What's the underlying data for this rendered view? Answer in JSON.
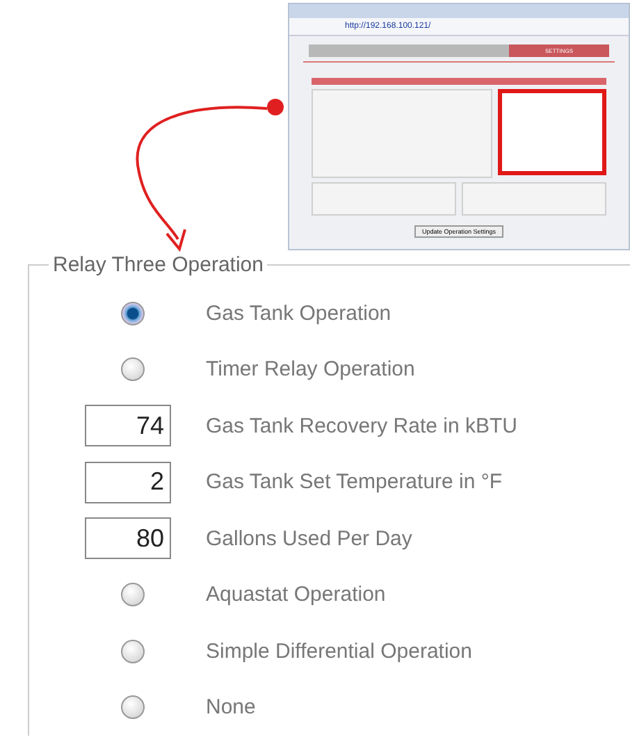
{
  "thumbnail": {
    "address": "http://192.168.100.121/",
    "tabs": [
      {
        "selected": false
      },
      {
        "selected": false
      },
      {
        "label": "SETTINGS",
        "selected": true
      }
    ],
    "button": "Update Operation Settings"
  },
  "relay_three_operation": {
    "title": "Relay Three Operation",
    "rows": [
      {
        "kind": "radio",
        "label": "Gas Tank Operation",
        "selected": true
      },
      {
        "kind": "radio",
        "label": "Timer Relay Operation",
        "selected": false
      },
      {
        "kind": "input",
        "label": "Gas Tank Recovery Rate in kBTU",
        "value": "74"
      },
      {
        "kind": "input",
        "label": "Gas Tank Set Temperature in °F",
        "value": "2"
      },
      {
        "kind": "input",
        "label": "Gallons Used Per Day",
        "value": "80"
      },
      {
        "kind": "radio",
        "label": "Aquastat Operation",
        "selected": false
      },
      {
        "kind": "radio",
        "label": "Simple Differential Operation",
        "selected": false
      },
      {
        "kind": "radio",
        "label": "None",
        "selected": false
      }
    ]
  }
}
